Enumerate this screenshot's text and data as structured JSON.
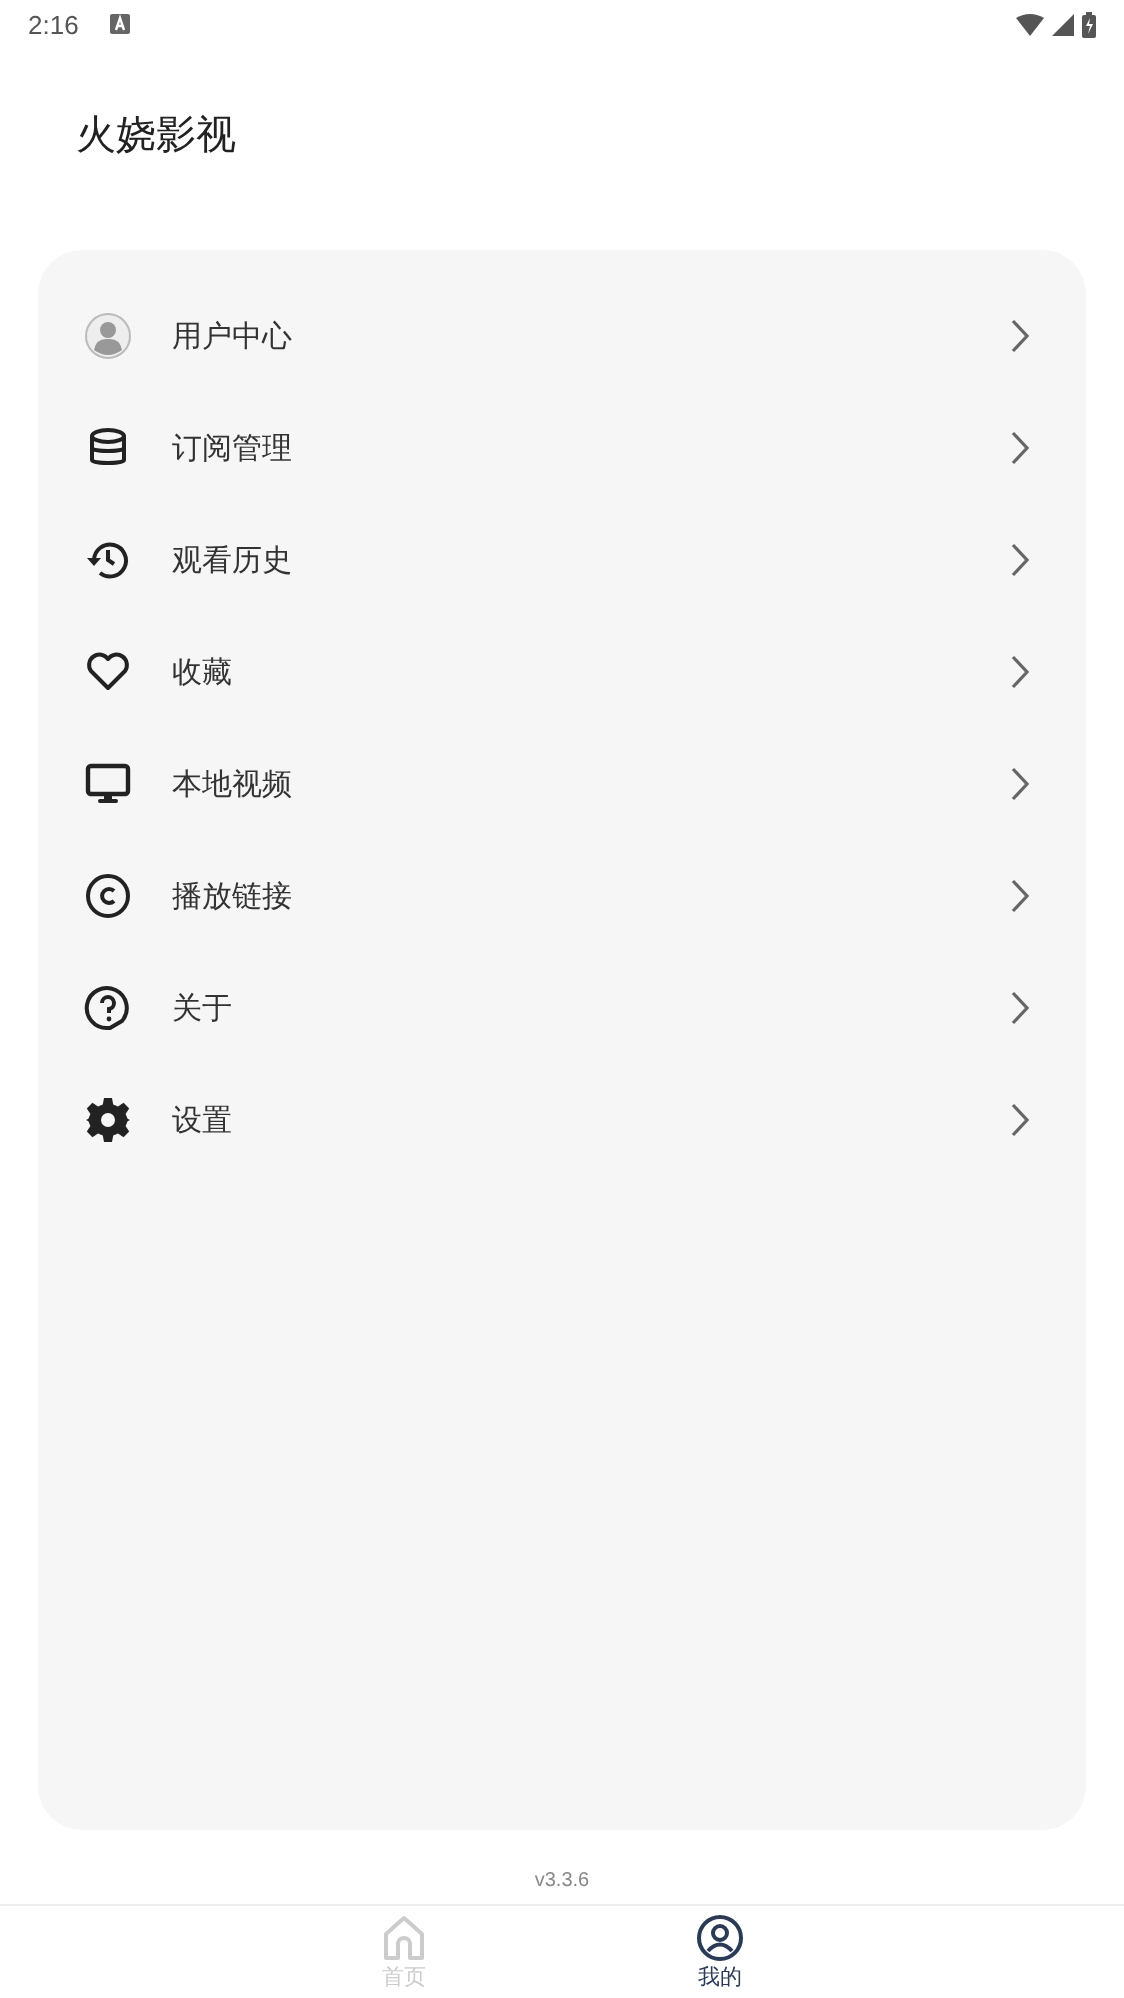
{
  "status_bar": {
    "time": "2:16"
  },
  "title": "火娆影视",
  "menu": [
    {
      "kind": "user",
      "label": "用户中心"
    },
    {
      "kind": "database",
      "label": "订阅管理"
    },
    {
      "kind": "history",
      "label": "观看历史"
    },
    {
      "kind": "heart",
      "label": "收藏"
    },
    {
      "kind": "monitor",
      "label": "本地视频"
    },
    {
      "kind": "copyright",
      "label": "播放链接"
    },
    {
      "kind": "help",
      "label": "关于"
    },
    {
      "kind": "settings",
      "label": "设置"
    }
  ],
  "version": "v3.3.6",
  "nav": [
    {
      "kind": "home",
      "label": "首页",
      "selected": false
    },
    {
      "kind": "profile",
      "label": "我的",
      "selected": true
    }
  ]
}
